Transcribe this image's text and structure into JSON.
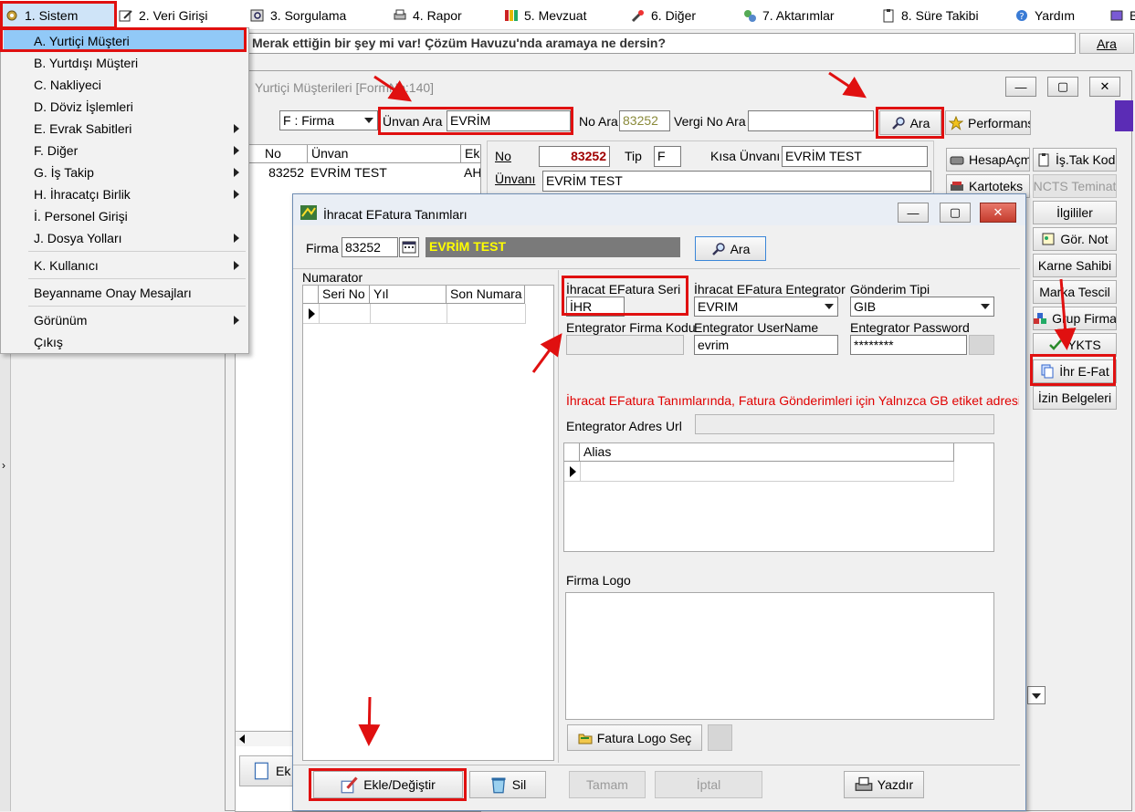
{
  "menubar": {
    "items": [
      {
        "label": "1.  Sistem",
        "icon": "settings-icon"
      },
      {
        "label": "2.  Veri Girişi",
        "icon": "edit-icon"
      },
      {
        "label": "3.  Sorgulama",
        "icon": "query-icon"
      },
      {
        "label": "4.  Rapor",
        "icon": "printer-icon"
      },
      {
        "label": "5.  Mevzuat",
        "icon": "books-icon"
      },
      {
        "label": "6.  Diğer",
        "icon": "tools-icon"
      },
      {
        "label": "7.  Aktarımlar",
        "icon": "transfer-icon"
      },
      {
        "label": "8. Süre Takibi",
        "icon": "clipboard-icon"
      },
      {
        "label": "Yardım",
        "icon": "help-icon"
      },
      {
        "label": "B",
        "icon": "book-icon"
      }
    ]
  },
  "search_strip": {
    "value": "Merak ettiğin bir şey mi var! Çözüm Havuzu'nda aramaya ne dersin?",
    "button": "Ara"
  },
  "dropdown": {
    "items": [
      {
        "label": "A.  Yurtiçi Müşteri",
        "has_sub": false
      },
      {
        "label": "B.  Yurtdışı Müşteri",
        "has_sub": false
      },
      {
        "label": "C.  Nakliyeci",
        "has_sub": false
      },
      {
        "label": "D.  Döviz İşlemleri",
        "has_sub": false
      },
      {
        "label": "E.  Evrak Sabitleri",
        "has_sub": true
      },
      {
        "label": "F.  Diğer",
        "has_sub": true
      },
      {
        "label": "G.  İş Takip",
        "has_sub": true
      },
      {
        "label": "H.  İhracatçı Birlik",
        "has_sub": true
      },
      {
        "label": "İ.   Personel Girişi",
        "has_sub": false
      },
      {
        "label": "J.  Dosya Yolları",
        "has_sub": true
      },
      {
        "label": "K.  Kullanıcı",
        "has_sub": true
      },
      {
        "label": "Beyanname Onay Mesajları",
        "has_sub": false
      },
      {
        "label": "Görünüm",
        "has_sub": true
      },
      {
        "label": "Çıkış",
        "has_sub": false
      }
    ]
  },
  "bg_window": {
    "title": "Yurtiçi Müşterileri [FormNo:140]",
    "filter_combo": "F : Firma",
    "unvan_label": "Ünvan Ara",
    "unvan_value": "EVRİM",
    "no_label": "No Ara",
    "no_value": "83252",
    "vergi_label": "Vergi No Ara",
    "vergi_value": "",
    "search_button": "Ara",
    "performans_button": "Performans",
    "grid": {
      "columns": [
        "No",
        "Ünvan",
        "Ek"
      ],
      "rows": [
        [
          "83252",
          "EVRİM TEST",
          "AH"
        ]
      ]
    },
    "detail": {
      "no_label": "No",
      "no_value": "83252",
      "tip_label": "Tip",
      "tip_value": "F",
      "kisa_label": "Kısa Ünvanı",
      "kisa_value": "EVRİM TEST",
      "unvan_label": "Ünvanı",
      "unvan_value": "EVRİM TEST"
    },
    "side_buttons": [
      {
        "label": "HesapAçm",
        "icon": "account-icon",
        "enabled": true
      },
      {
        "label": "İş.Tak Kod",
        "icon": "clipboard-icon",
        "enabled": true
      },
      {
        "label": "Kartoteks",
        "icon": "cardfile-icon",
        "enabled": true
      },
      {
        "label": "NCTS Teminat",
        "icon": "",
        "enabled": false
      },
      {
        "label": "İlgililer",
        "icon": "",
        "enabled": true
      },
      {
        "label": "Gör. Not",
        "icon": "note-icon",
        "enabled": true
      },
      {
        "label": "Karne Sahibi",
        "icon": "",
        "enabled": true
      },
      {
        "label": "Marka Tescil",
        "icon": "",
        "enabled": true
      },
      {
        "label": "Grup Firma",
        "icon": "group-icon",
        "enabled": true
      },
      {
        "label": "YKTS",
        "icon": "check-icon",
        "enabled": true
      },
      {
        "label": "İhr E-Fat",
        "icon": "document-icon",
        "enabled": true
      },
      {
        "label": "İzin Belgeleri",
        "icon": "",
        "enabled": true
      }
    ],
    "bottom_button": "Ek"
  },
  "dialog": {
    "title": "İhracat EFatura Tanımları",
    "firma_label": "Firma",
    "firma_no": "83252",
    "firma_name": "EVRİM TEST",
    "ara_button": "Ara",
    "numarator_label": "Numarator",
    "num_columns": [
      "Seri No",
      "Yıl",
      "Son Numara"
    ],
    "seri_label": "İhracat EFatura Seri",
    "seri_value": "İHR",
    "entegrator_label": "İhracat EFatura Entegrator",
    "entegrator_value": "EVRIM",
    "gonderim_label": "Gönderim Tipi",
    "gonderim_value": "GIB",
    "firmakodu_label": "Entegrator Firma Kodu",
    "firmakodu_value": "",
    "username_label": "Entegrator UserName",
    "username_value": "evrim",
    "password_label": "Entegrator Password",
    "password_value": "********",
    "warning": "İhracat EFatura Tanımlarında, Fatura Gönderimleri için Yalnızca GB etiket adresi",
    "adres_label": "Entegrator Adres Url",
    "adres_value": "",
    "alias_column": "Alias",
    "logo_label": "Firma Logo",
    "logo_button": "Fatura Logo Seç",
    "buttons": {
      "ekle": "Ekle/Değiştir",
      "sil": "Sil",
      "tamam": "Tamam",
      "iptal": "İptal",
      "yazdir": "Yazdır"
    }
  },
  "colors": {
    "accent_red": "#e01010",
    "menu_highlight": "#91c9f7",
    "firma_name_bg": "#7a7a7a",
    "firma_name_fg": "#ffff00",
    "warning_red": "#e00000",
    "no_value_red": "#a00000"
  }
}
